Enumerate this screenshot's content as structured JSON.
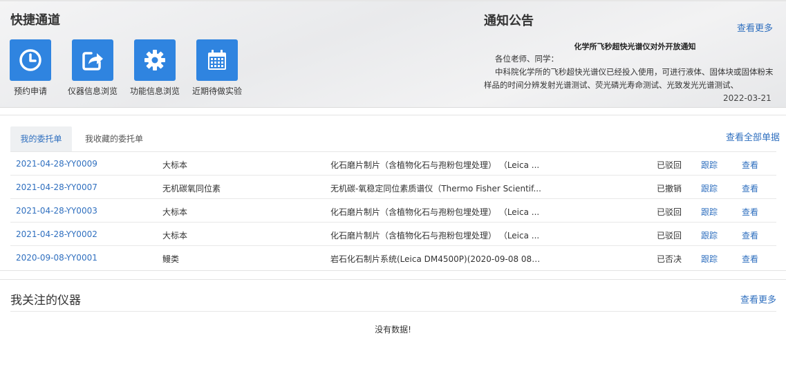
{
  "quick": {
    "title": "快捷通道",
    "items": [
      {
        "label": "预约申请",
        "icon": "clock-icon"
      },
      {
        "label": "仪器信息浏览",
        "icon": "share-icon"
      },
      {
        "label": "功能信息浏览",
        "icon": "gear-icon"
      },
      {
        "label": "近期待做实验",
        "icon": "calendar-icon"
      }
    ],
    "accent": "#2f84e0"
  },
  "notice": {
    "title": "通知公告",
    "more": "查看更多",
    "headline": "化学所飞秒超快光谱仪对外开放通知",
    "greeting": "各位老师、同学：",
    "body": "中科院化学所的飞秒超快光谱仪已经投入使用，可进行液体、固体块或固体粉末样品的时间分辨发射光谱测试、荧光磷光寿命测试、光致发光光谱测试、",
    "date": "2022-03-21"
  },
  "orders": {
    "tabs": [
      "我的委托单",
      "我收藏的委托单"
    ],
    "view_all": "查看全部单据",
    "track_label": "跟踪",
    "view_label": "查看",
    "rows": [
      {
        "id": "2021-04-28-YY0009",
        "type": "大标本",
        "desc": "化石磨片制片（含植物化石与孢粉包埋处理） （Leica ...",
        "status": "已驳回"
      },
      {
        "id": "2021-04-28-YY0007",
        "type": "无机碳氧同位素",
        "desc": "无机碳-氧稳定同位素质谱仪（Thermo Fisher Scientif...",
        "status": "已撤销"
      },
      {
        "id": "2021-04-28-YY0003",
        "type": "大标本",
        "desc": "化石磨片制片（含植物化石与孢粉包埋处理） （Leica ...",
        "status": "已驳回"
      },
      {
        "id": "2021-04-28-YY0002",
        "type": "大标本",
        "desc": "化石磨片制片（含植物化石与孢粉包埋处理） （Leica ...",
        "status": "已驳回"
      },
      {
        "id": "2020-09-08-YY0001",
        "type": "鳗类",
        "desc": "岩石化石制片系统(Leica DM4500P)(2020-09-08 08:...",
        "status": "已否决"
      }
    ]
  },
  "fav": {
    "title": "我关注的仪器",
    "more": "查看更多",
    "empty": "没有数据!"
  }
}
